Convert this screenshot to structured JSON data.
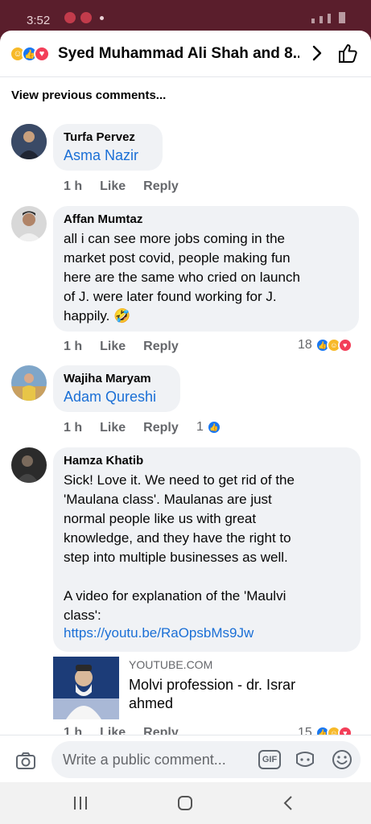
{
  "status": {
    "time": "3:52"
  },
  "header": {
    "title": "Syed Muhammad Ali Shah and 8...",
    "reaction_icons": [
      "haha-icon",
      "like-icon",
      "love-icon"
    ]
  },
  "view_previous": "View previous comments...",
  "comments": [
    {
      "name": "Turfa Pervez",
      "tag": "Asma Nazir",
      "time": "1 h",
      "like": "Like",
      "reply": "Reply"
    },
    {
      "name": "Affan Mumtaz",
      "text": "all i can see more jobs coming in the\nmarket post covid, people making fun\nhere are the same who cried on launch\nof J. were later found working for J.\nhappily.",
      "emoji": "🤣",
      "time": "1 h",
      "like": "Like",
      "reply": "Reply",
      "reaction_count": "18"
    },
    {
      "name": "Wajiha Maryam",
      "tag": "Adam Qureshi",
      "time": "1 h",
      "like": "Like",
      "reply": "Reply",
      "reaction_count": "1"
    },
    {
      "name": "Hamza Khatib",
      "text": "Sick! Love it. We need to get rid of the\n'Maulana class'. Maulanas are just\nnormal people like us with great\nknowledge, and they have the right to\nstep into multiple businesses as well.\n\nA video for explanation of the 'Maulvi\nclass':",
      "link": "https://youtu.be/RaOpsbMs9Jw",
      "time": "1 h",
      "like": "Like",
      "reply": "Reply",
      "reaction_count": "15"
    }
  ],
  "link_preview": {
    "site": "YOUTUBE.COM",
    "title": "Molvi profession - dr. Israr\nahmed"
  },
  "composer": {
    "placeholder": "Write a public comment...",
    "gif": "GIF"
  },
  "colors": {
    "accent": "#1877f2",
    "link": "#1a6fd6",
    "status_bar": "#5a1e2c"
  }
}
